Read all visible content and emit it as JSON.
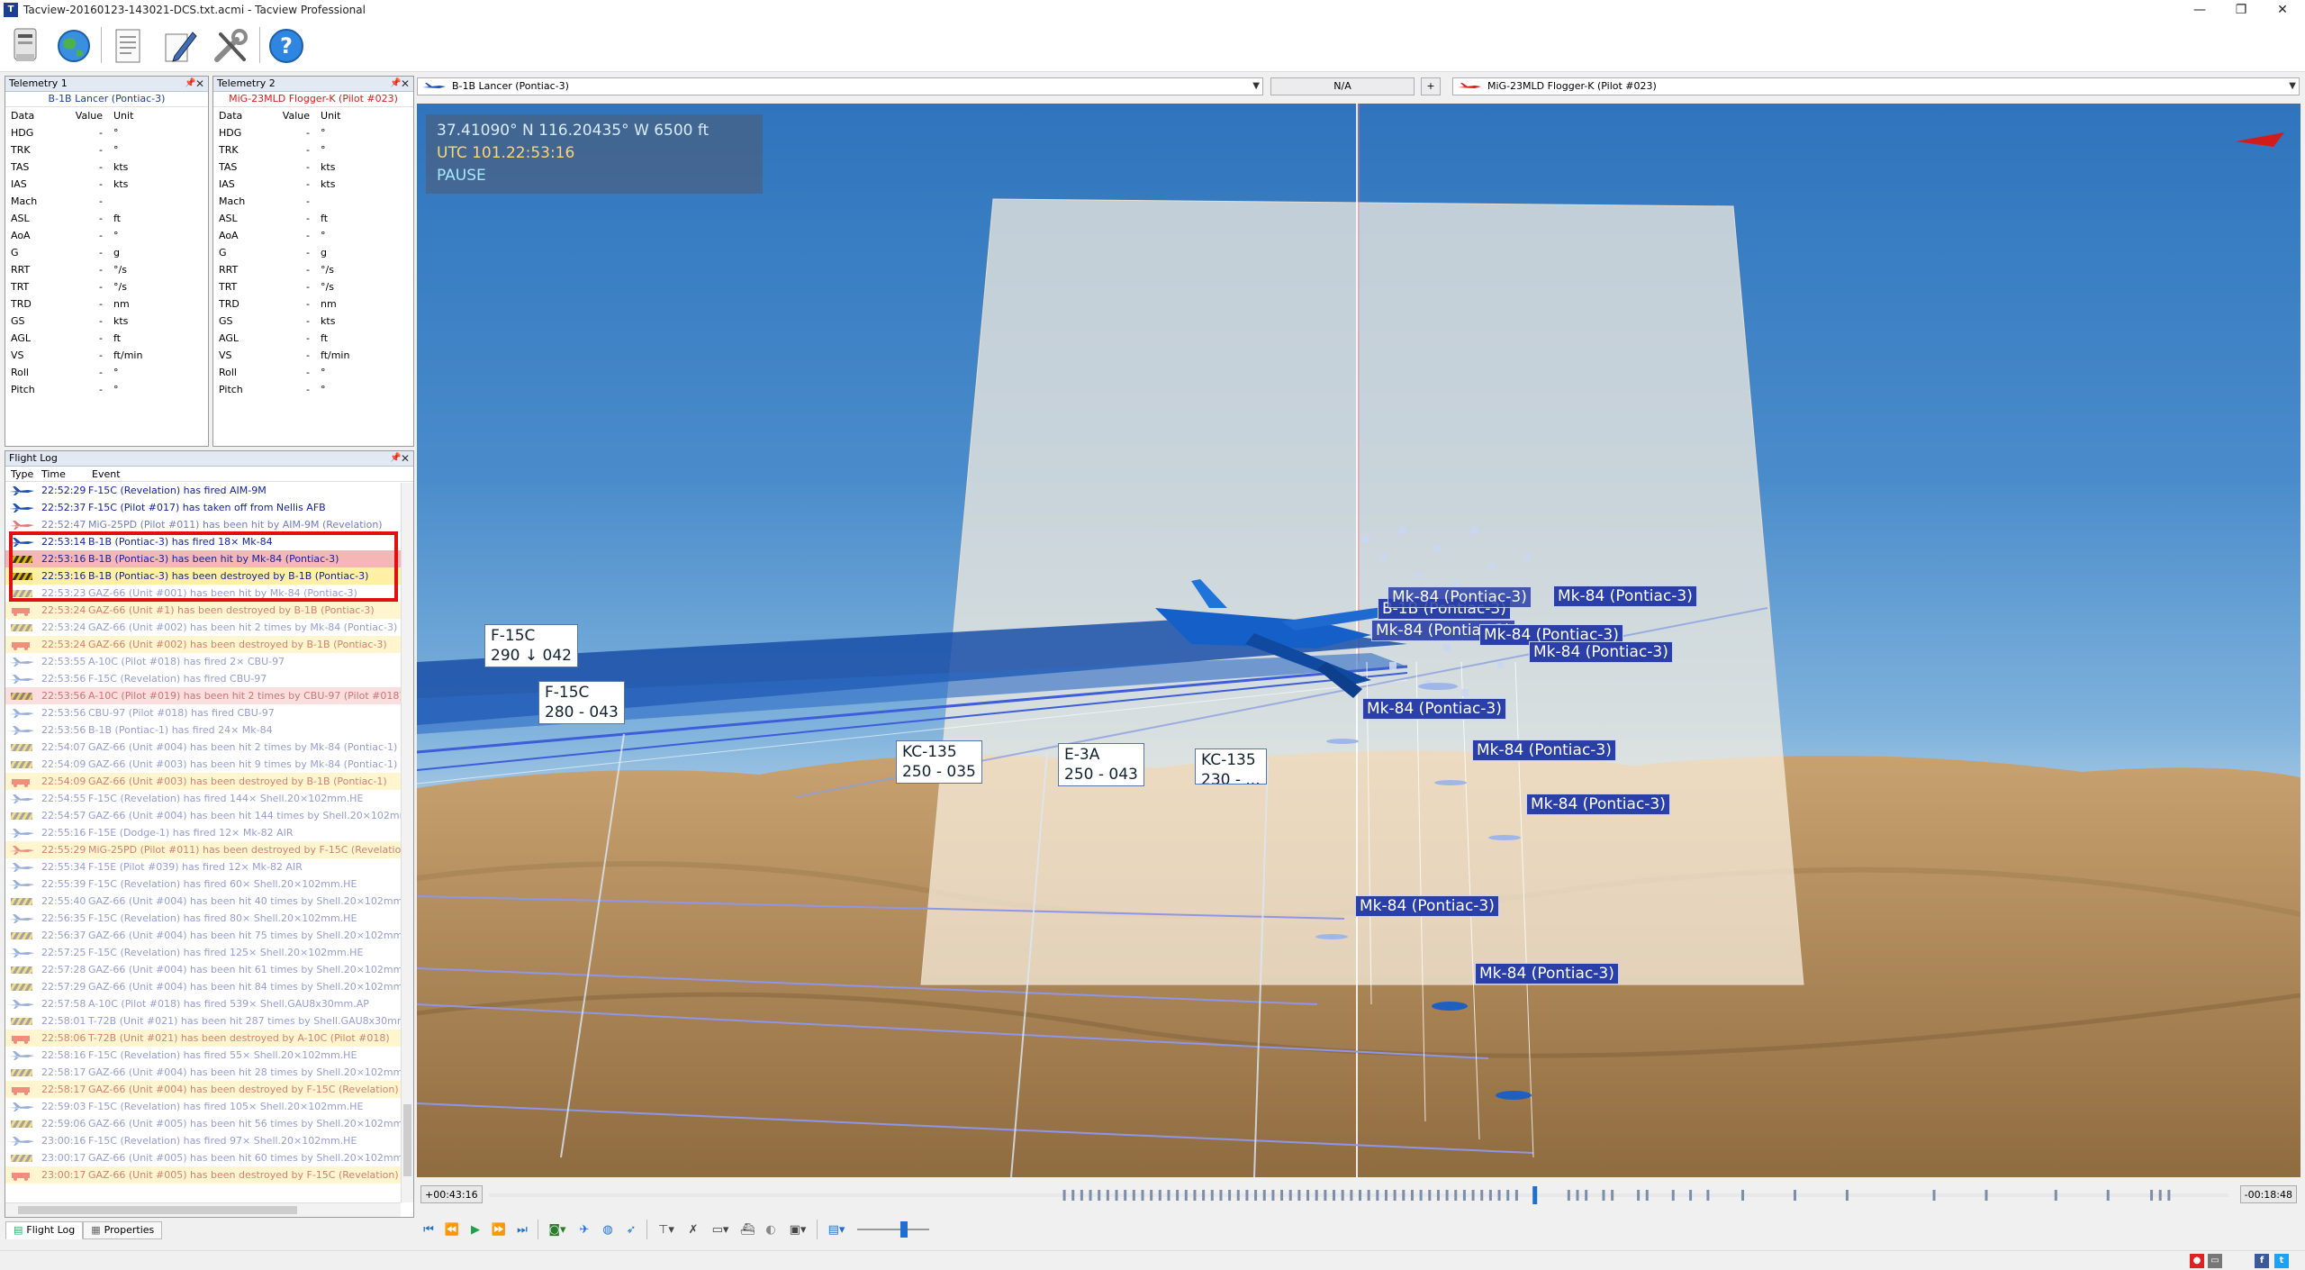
{
  "window": {
    "title": "Tacview-20160123-143021-DCS.txt.acmi - Tacview Professional",
    "controls": [
      "—",
      "❐",
      "✕"
    ]
  },
  "toolbar": {
    "items": [
      "open-file",
      "online",
      "flight-log",
      "edit",
      "settings",
      "help"
    ]
  },
  "telemetry1": {
    "title": "Telemetry 1",
    "object": "B-1B Lancer (Pontiac-3)",
    "headers": {
      "data": "Data",
      "value": "Value",
      "unit": "Unit"
    },
    "rows": [
      {
        "name": "HDG",
        "value": "-",
        "unit": "°"
      },
      {
        "name": "TRK",
        "value": "-",
        "unit": "°"
      },
      {
        "name": "TAS",
        "value": "-",
        "unit": "kts"
      },
      {
        "name": "IAS",
        "value": "-",
        "unit": "kts"
      },
      {
        "name": "Mach",
        "value": "-",
        "unit": ""
      },
      {
        "name": "ASL",
        "value": "-",
        "unit": "ft"
      },
      {
        "name": "AoA",
        "value": "-",
        "unit": "°"
      },
      {
        "name": "G",
        "value": "-",
        "unit": "g"
      },
      {
        "name": "RRT",
        "value": "-",
        "unit": "°/s"
      },
      {
        "name": "TRT",
        "value": "-",
        "unit": "°/s"
      },
      {
        "name": "TRD",
        "value": "-",
        "unit": "nm"
      },
      {
        "name": "GS",
        "value": "-",
        "unit": "kts"
      },
      {
        "name": "AGL",
        "value": "-",
        "unit": "ft"
      },
      {
        "name": "VS",
        "value": "-",
        "unit": "ft/min"
      },
      {
        "name": "Roll",
        "value": "-",
        "unit": "°"
      },
      {
        "name": "Pitch",
        "value": "-",
        "unit": "°"
      }
    ]
  },
  "telemetry2": {
    "title": "Telemetry 2",
    "object": "MiG-23MLD Flogger-K (Pilot #023)",
    "headers": {
      "data": "Data",
      "value": "Value",
      "unit": "Unit"
    },
    "rows": [
      {
        "name": "HDG",
        "value": "-",
        "unit": "°"
      },
      {
        "name": "TRK",
        "value": "-",
        "unit": "°"
      },
      {
        "name": "TAS",
        "value": "-",
        "unit": "kts"
      },
      {
        "name": "IAS",
        "value": "-",
        "unit": "kts"
      },
      {
        "name": "Mach",
        "value": "-",
        "unit": ""
      },
      {
        "name": "ASL",
        "value": "-",
        "unit": "ft"
      },
      {
        "name": "AoA",
        "value": "-",
        "unit": "°"
      },
      {
        "name": "G",
        "value": "-",
        "unit": "g"
      },
      {
        "name": "RRT",
        "value": "-",
        "unit": "°/s"
      },
      {
        "name": "TRT",
        "value": "-",
        "unit": "°/s"
      },
      {
        "name": "TRD",
        "value": "-",
        "unit": "nm"
      },
      {
        "name": "GS",
        "value": "-",
        "unit": "kts"
      },
      {
        "name": "AGL",
        "value": "-",
        "unit": "ft"
      },
      {
        "name": "VS",
        "value": "-",
        "unit": "ft/min"
      },
      {
        "name": "Roll",
        "value": "-",
        "unit": "°"
      },
      {
        "name": "Pitch",
        "value": "-",
        "unit": "°"
      }
    ]
  },
  "flightlog": {
    "title": "Flight Log",
    "headers": {
      "type": "Type",
      "time": "Time",
      "event": "Event"
    },
    "rows": [
      {
        "icon": "blue-jet",
        "time": "22:52:29",
        "event": "F-15C (Revelation) has fired AIM-9M",
        "style": "normal"
      },
      {
        "icon": "blue-jet",
        "time": "22:52:37",
        "event": "F-15C (Pilot #017) has taken off from Nellis AFB",
        "style": "normal"
      },
      {
        "icon": "red-jet",
        "time": "22:52:47",
        "event": "MiG-25PD (Pilot #011) has been hit by AIM-9M (Revelation)",
        "style": "normal"
      },
      {
        "icon": "blue-jet",
        "time": "22:53:14",
        "event": "B-1B (Pontiac-3) has fired 18× Mk-84",
        "style": "normal"
      },
      {
        "icon": "blue-hit",
        "time": "22:53:16",
        "event": "B-1B (Pontiac-3) has been hit by Mk-84 (Pontiac-3)",
        "style": "hit"
      },
      {
        "icon": "blue-destroyed",
        "time": "22:53:16",
        "event": "B-1B (Pontiac-3) has been destroyed by B-1B (Pontiac-3)",
        "style": "destroyed"
      },
      {
        "icon": "hit",
        "time": "22:53:23",
        "event": "GAZ-66 (Unit #001) has been hit by Mk-84 (Pontiac-3)",
        "style": "faded"
      },
      {
        "icon": "red-vehicle",
        "time": "22:53:24",
        "event": "GAZ-66 (Unit #1) has been destroyed by B-1B (Pontiac-3)",
        "style": "faded-destroyed"
      },
      {
        "icon": "hit",
        "time": "22:53:24",
        "event": "GAZ-66 (Unit #002) has been hit 2 times by Mk-84 (Pontiac-3)",
        "style": "faded"
      },
      {
        "icon": "red-vehicle",
        "time": "22:53:24",
        "event": "GAZ-66 (Unit #002) has been destroyed by B-1B (Pontiac-3)",
        "style": "faded-destroyed"
      },
      {
        "icon": "blue-jet",
        "time": "22:53:55",
        "event": "A-10C (Pilot #018) has fired 2× CBU-97",
        "style": "faded"
      },
      {
        "icon": "blue-jet",
        "time": "22:53:56",
        "event": "F-15C (Revelation) has fired CBU-97",
        "style": "faded"
      },
      {
        "icon": "red-hit",
        "time": "22:53:56",
        "event": "A-10C (Pilot #019) has been hit 2 times by CBU-97 (Pilot #018)",
        "style": "faded-hit"
      },
      {
        "icon": "blue-jet",
        "time": "22:53:56",
        "event": "CBU-97 (Pilot #018) has fired CBU-97",
        "style": "faded"
      },
      {
        "icon": "blue-jet",
        "time": "22:53:56",
        "event": "B-1B (Pontiac-1) has fired 24× Mk-84",
        "style": "faded"
      },
      {
        "icon": "hit",
        "time": "22:54:07",
        "event": "GAZ-66 (Unit #004) has been hit 2 times by Mk-84 (Pontiac-1)",
        "style": "faded"
      },
      {
        "icon": "hit",
        "time": "22:54:09",
        "event": "GAZ-66 (Unit #003) has been hit 9 times by Mk-84 (Pontiac-1)",
        "style": "faded"
      },
      {
        "icon": "red-vehicle",
        "time": "22:54:09",
        "event": "GAZ-66 (Unit #003) has been destroyed by B-1B (Pontiac-1)",
        "style": "faded-destroyed"
      },
      {
        "icon": "blue-jet",
        "time": "22:54:55",
        "event": "F-15C (Revelation) has fired 144× Shell.20×102mm.HE",
        "style": "faded"
      },
      {
        "icon": "hit",
        "time": "22:54:57",
        "event": "GAZ-66 (Unit #004) has been hit 144 times by Shell.20×102mm...",
        "style": "faded"
      },
      {
        "icon": "blue-jet",
        "time": "22:55:16",
        "event": "F-15E (Dodge-1) has fired 12× Mk-82 AIR",
        "style": "faded"
      },
      {
        "icon": "red-destroyed",
        "time": "22:55:29",
        "event": "MiG-25PD (Pilot #011) has been destroyed by F-15C (Revelation)",
        "style": "faded-destroyed"
      },
      {
        "icon": "blue-jet",
        "time": "22:55:34",
        "event": "F-15E (Pilot #039) has fired 12× Mk-82 AIR",
        "style": "faded"
      },
      {
        "icon": "blue-jet",
        "time": "22:55:39",
        "event": "F-15C (Revelation) has fired 60× Shell.20×102mm.HE",
        "style": "faded"
      },
      {
        "icon": "hit",
        "time": "22:55:40",
        "event": "GAZ-66 (Unit #004) has been hit 40 times by Shell.20×102mm.HE",
        "style": "faded"
      },
      {
        "icon": "blue-jet",
        "time": "22:56:35",
        "event": "F-15C (Revelation) has fired 80× Shell.20×102mm.HE",
        "style": "faded"
      },
      {
        "icon": "hit",
        "time": "22:56:37",
        "event": "GAZ-66 (Unit #004) has been hit 75 times by Shell.20×102mm.H",
        "style": "faded"
      },
      {
        "icon": "blue-jet",
        "time": "22:57:25",
        "event": "F-15C (Revelation) has fired 125× Shell.20×102mm.HE",
        "style": "faded"
      },
      {
        "icon": "hit",
        "time": "22:57:28",
        "event": "GAZ-66 (Unit #004) has been hit 61 times by Shell.20×102mm.H",
        "style": "faded"
      },
      {
        "icon": "hit",
        "time": "22:57:29",
        "event": "GAZ-66 (Unit #004) has been hit 84 times by Shell.20×102mm.H",
        "style": "faded"
      },
      {
        "icon": "blue-jet",
        "time": "22:57:58",
        "event": "A-10C (Pilot #018) has fired 539× Shell.GAU8x30mm.AP",
        "style": "faded"
      },
      {
        "icon": "hit",
        "time": "22:58:01",
        "event": "T-72B (Unit #021) has been hit 287 times by Shell.GAU8x30mm",
        "style": "faded"
      },
      {
        "icon": "red-vehicle",
        "time": "22:58:06",
        "event": "T-72B (Unit #021) has been destroyed by A-10C (Pilot #018)",
        "style": "faded-destroyed"
      },
      {
        "icon": "blue-jet",
        "time": "22:58:16",
        "event": "F-15C (Revelation) has fired 55× Shell.20×102mm.HE",
        "style": "faded"
      },
      {
        "icon": "hit",
        "time": "22:58:17",
        "event": "GAZ-66 (Unit #004) has been hit 28 times by Shell.20×102mm.H",
        "style": "faded"
      },
      {
        "icon": "red-vehicle",
        "time": "22:58:17",
        "event": "GAZ-66 (Unit #004) has been destroyed by F-15C (Revelation)",
        "style": "faded-destroyed"
      },
      {
        "icon": "blue-jet",
        "time": "22:59:03",
        "event": "F-15C (Revelation) has fired 105× Shell.20×102mm.HE",
        "style": "faded"
      },
      {
        "icon": "hit",
        "time": "22:59:06",
        "event": "GAZ-66 (Unit #005) has been hit 56 times by Shell.20×102mm.H",
        "style": "faded"
      },
      {
        "icon": "blue-jet",
        "time": "23:00:16",
        "event": "F-15C (Revelation) has fired 97× Shell.20×102mm.HE",
        "style": "faded"
      },
      {
        "icon": "hit",
        "time": "23:00:17",
        "event": "GAZ-66 (Unit #005) has been hit 60 times by Shell.20×102mm.H",
        "style": "faded"
      },
      {
        "icon": "red-vehicle",
        "time": "23:00:17",
        "event": "GAZ-66 (Unit #005) has been destroyed by F-15C (Revelation)",
        "style": "faded-destroyed"
      }
    ]
  },
  "bottom_tabs": [
    {
      "label": "Flight Log",
      "active": true
    },
    {
      "label": "Properties",
      "active": false
    }
  ],
  "selection": {
    "left_object": "B-1B Lancer (Pontiac-3)",
    "distance": "N/A",
    "plus": "+",
    "right_object": "MiG-23MLD Flogger-K (Pilot #023)"
  },
  "hud": {
    "coords": "37.41090° N  116.20435° W  6500 ft",
    "utc": "UTC 101.22:53:16",
    "state": "PAUSE"
  },
  "labels": [
    {
      "text": "B-1B (Pontiac-3)",
      "kind": "blue"
    },
    {
      "text": "Mk-84 (Pontiac-3)",
      "kind": "blue"
    },
    {
      "text": "Mk-84 (Pontiac-3)",
      "kind": "blue"
    },
    {
      "text": "Mk-84 (Pontiac-3)",
      "kind": "blue"
    },
    {
      "text": "Mk-84 (Pontiac-3)",
      "kind": "blue"
    },
    {
      "text": "Mk-84 (Pontiac-3)",
      "kind": "blue"
    },
    {
      "text": "Mk-84 (Pontiac-3)",
      "kind": "blue"
    },
    {
      "text": "Mk-84 (Pontiac-3)",
      "kind": "blue"
    },
    {
      "text": "Mk-84 (Pontiac-3)",
      "kind": "blue"
    },
    {
      "text": "Mk-84 (Pontiac-3)",
      "kind": "blue"
    },
    {
      "text": "Mk-84 (Pontiac-3)",
      "kind": "blue"
    }
  ],
  "aircraft_labels": [
    {
      "name": "F-15C",
      "info": "290 ↓ 042"
    },
    {
      "name": "F-15C",
      "info": "280 - 043"
    },
    {
      "name": "KC-135",
      "info": "250 - 035"
    },
    {
      "name": "E-3A",
      "info": "250 - 043"
    },
    {
      "name": "KC-135",
      "info": "230 - ..."
    }
  ],
  "timeline": {
    "start": "+00:43:16",
    "end": "-00:18:48",
    "position": 0.6
  },
  "colors": {
    "hit_row": "#f7b6b6",
    "destroyed_row": "#fff0a6",
    "sky": "#3f84c8",
    "desert": "#b08c5a",
    "label_bg": "#2a3fa8",
    "highlight_box": "#e01010"
  }
}
